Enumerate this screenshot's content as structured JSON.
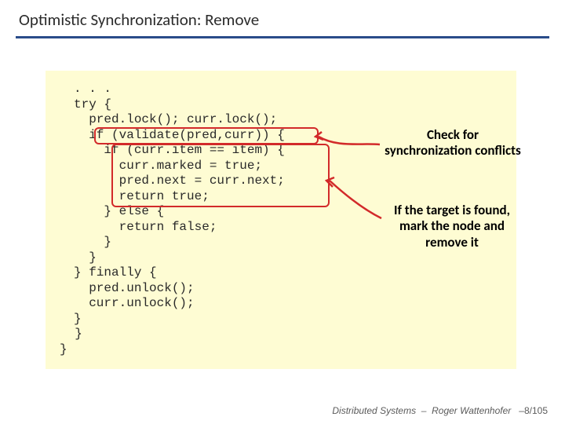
{
  "title": "Optimistic Synchronization: Remove",
  "code": {
    "l1": ". . .",
    "l2": "try {",
    "l3": "  pred.lock(); curr.lock();",
    "l4": "  if (validate(pred,curr)) {",
    "l5": "    if (curr.item == item) {",
    "l6": "      curr.marked = true;",
    "l7": "      pred.next = curr.next;",
    "l8": "      return true;",
    "l9": "    } else {",
    "l10": "      return false;",
    "l11": "    }",
    "l12": "  }",
    "l13": "} finally {",
    "l14": "  pred.unlock();",
    "l15": "  curr.unlock();",
    "l16": "}"
  },
  "closing1": "  }",
  "closing2": "}",
  "annotations": {
    "a1_line1": "Check for",
    "a1_line2": "synchronization conflicts",
    "a2_line1": "If the target is found,",
    "a2_line2": "mark the node and",
    "a2_line3": "remove it"
  },
  "footer": {
    "course": "Distributed Systems",
    "sep": "–",
    "author": "Roger Wattenhofer",
    "page": "–8/105"
  }
}
